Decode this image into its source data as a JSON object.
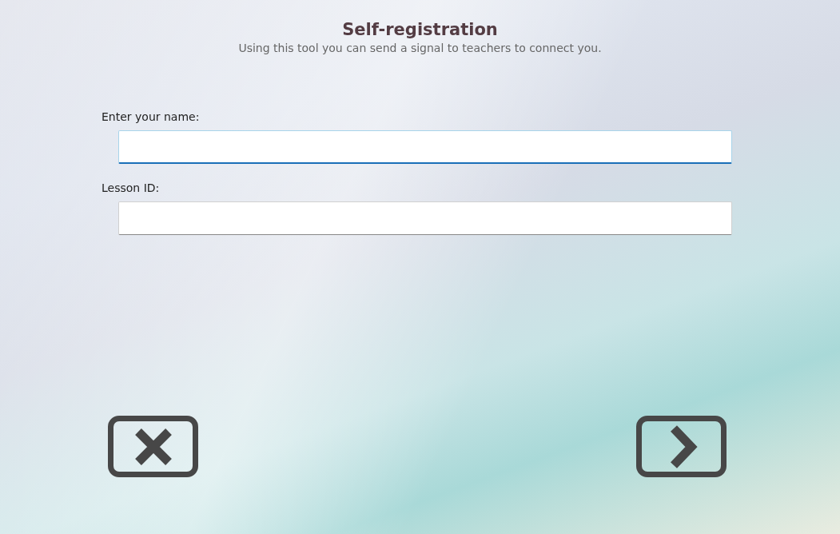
{
  "header": {
    "title": "Self-registration",
    "subtitle": "Using this tool you can send a signal to teachers to connect you."
  },
  "fields": [
    {
      "label": "Enter your name:",
      "focused": true
    },
    {
      "label": "Lesson ID:",
      "focused": false
    }
  ],
  "buttons": [
    {
      "kind": "cancel"
    },
    {
      "kind": "next"
    }
  ]
}
